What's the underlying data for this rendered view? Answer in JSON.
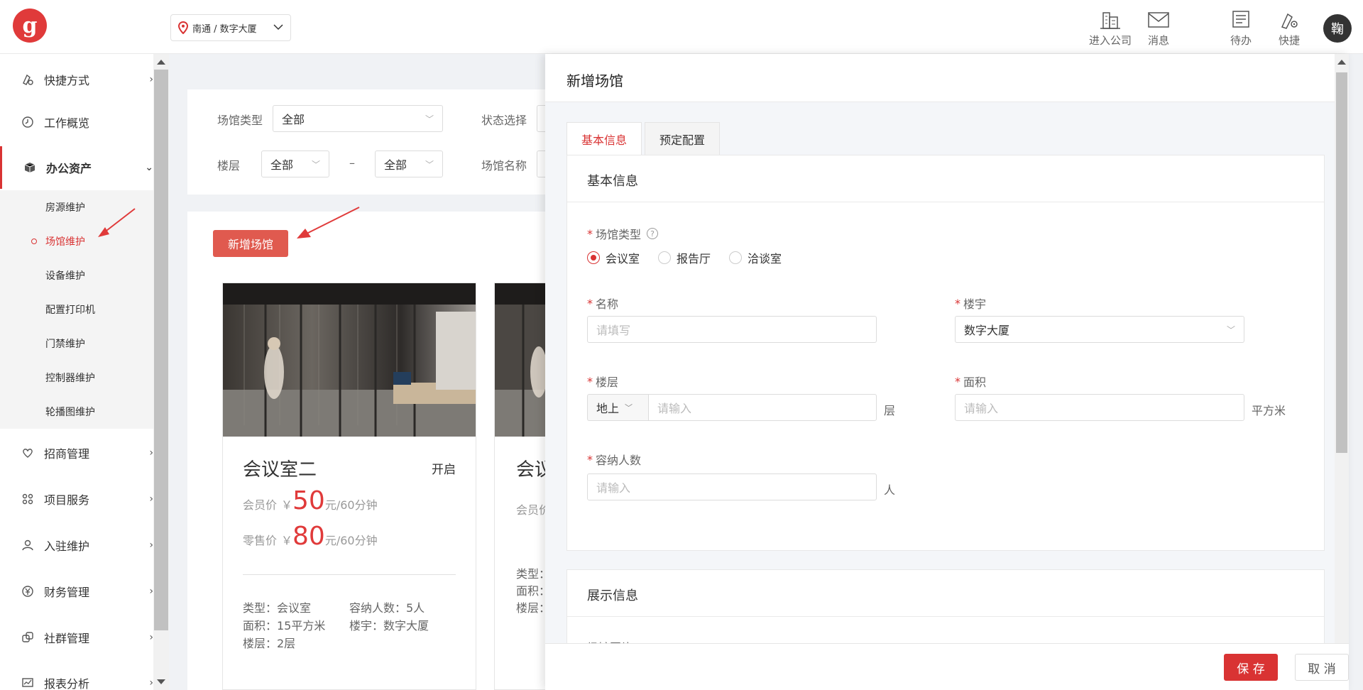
{
  "header": {
    "logo_letter": "g",
    "location": "南通 / 数字大厦",
    "enter_company": "进入公司",
    "messages": "消息",
    "todo": "待办",
    "shortcut": "快捷",
    "avatar_text": "鞠"
  },
  "sidebar": {
    "items": [
      {
        "label": "快捷方式",
        "icon": "shortcut-icon"
      },
      {
        "label": "工作概览",
        "icon": "clock-icon"
      },
      {
        "label": "办公资产",
        "icon": "box-icon"
      },
      {
        "label": "招商管理",
        "icon": "heart-icon"
      },
      {
        "label": "项目服务",
        "icon": "command-icon"
      },
      {
        "label": "入驻维护",
        "icon": "user-icon"
      },
      {
        "label": "财务管理",
        "icon": "money-icon"
      },
      {
        "label": "社群管理",
        "icon": "community-icon"
      },
      {
        "label": "报表分析",
        "icon": "chart-icon"
      }
    ],
    "subitems": [
      {
        "label": "房源维护"
      },
      {
        "label": "场馆维护"
      },
      {
        "label": "设备维护"
      },
      {
        "label": "配置打印机"
      },
      {
        "label": "门禁维护"
      },
      {
        "label": "控制器维护"
      },
      {
        "label": "轮播图维护"
      }
    ]
  },
  "filters": {
    "type_label": "场馆类型",
    "type_value": "全部",
    "status_label": "状态选择",
    "floor_label": "楼层",
    "floor_from": "全部",
    "dash": "–",
    "floor_to": "全部",
    "name_label": "场馆名称"
  },
  "list": {
    "add_button": "新增场馆",
    "cards": [
      {
        "name": "会议室二",
        "status": "开启",
        "member_label": "会员价",
        "currency": "￥",
        "member_price": "50",
        "unit": "元/60分钟",
        "retail_label": "零售价",
        "retail_price": "80",
        "type": "类型：会议室",
        "capacity": "容纳人数：5人",
        "area": "面积：15平方米",
        "building": "楼宇：数字大厦",
        "floor": "楼层：2层"
      },
      {
        "name": "会议",
        "member_label": "会员价",
        "type": "类型：",
        "area": "面积：",
        "floor": "楼层："
      }
    ]
  },
  "drawer": {
    "title": "新增场馆",
    "tabs": [
      "基本信息",
      "预定配置"
    ],
    "basic_section_title": "基本信息",
    "venue_type_label": "场馆类型",
    "help_glyph": "?",
    "venue_types": [
      "会议室",
      "报告厅",
      "洽谈室"
    ],
    "name_label": "名称",
    "name_placeholder": "请填写",
    "building_label": "楼宇",
    "building_value": "数字大厦",
    "floor_label": "楼层",
    "floor_prefix": "地上",
    "floor_placeholder": "请输入",
    "floor_suffix": "层",
    "area_label": "面积",
    "area_placeholder": "请输入",
    "area_suffix": "平方米",
    "capacity_label": "容纳人数",
    "capacity_placeholder": "请输入",
    "capacity_suffix": "人",
    "display_section_title": "展示信息",
    "display_partial_label": "场馆图片",
    "save": "保 存",
    "cancel": "取 消"
  },
  "colors": {
    "accent": "#d93333",
    "button_red": "#e05a4f"
  }
}
